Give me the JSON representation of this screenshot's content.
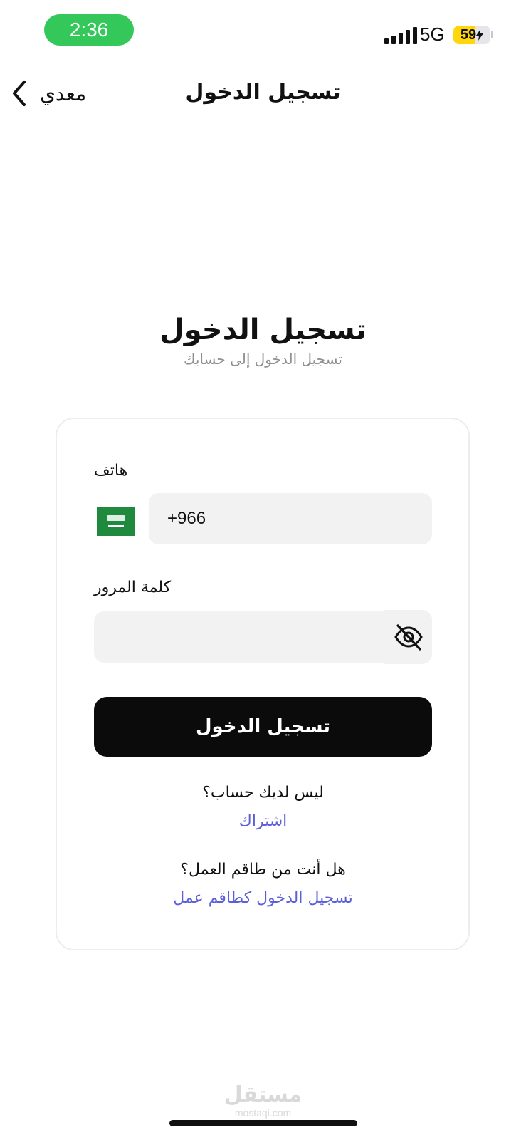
{
  "status_bar": {
    "time": "2:36",
    "network": "5G",
    "battery": "59",
    "battery_level": 0.59,
    "colors": {
      "time_pill": "#34c759",
      "battery_fill": "#ffd60a"
    },
    "icons": [
      "signal-icon",
      "battery-icon",
      "charging-bolt-icon"
    ]
  },
  "nav": {
    "back_label": "معدي",
    "title": "تسجيل الدخول",
    "back_icon": "chevron-left-icon"
  },
  "header": {
    "title": "تسجيل الدخول",
    "subtitle": "تسجيل الدخول إلى حسابك"
  },
  "form": {
    "phone_label": "هاتف",
    "phone_value": "+966",
    "country_flag": "saudi-arabia-flag-icon",
    "password_label": "كلمة المرور",
    "password_value": "",
    "password_toggle_icon": "eye-off-icon",
    "submit_label": "تسجيل الدخول"
  },
  "links": {
    "no_account_text": "ليس لديك حساب؟",
    "signup_label": "اشتراك",
    "team_question": "هل أنت من طاقم العمل؟",
    "team_login_label": "تسجيل الدخول كطاقم عمل"
  },
  "watermark": {
    "arabic": "مستقل",
    "latin": "mostaqi.com"
  },
  "theme": {
    "accent_link": "#5b5fd8",
    "button_bg": "#0b0b0b",
    "field_bg": "#f2f2f2"
  }
}
